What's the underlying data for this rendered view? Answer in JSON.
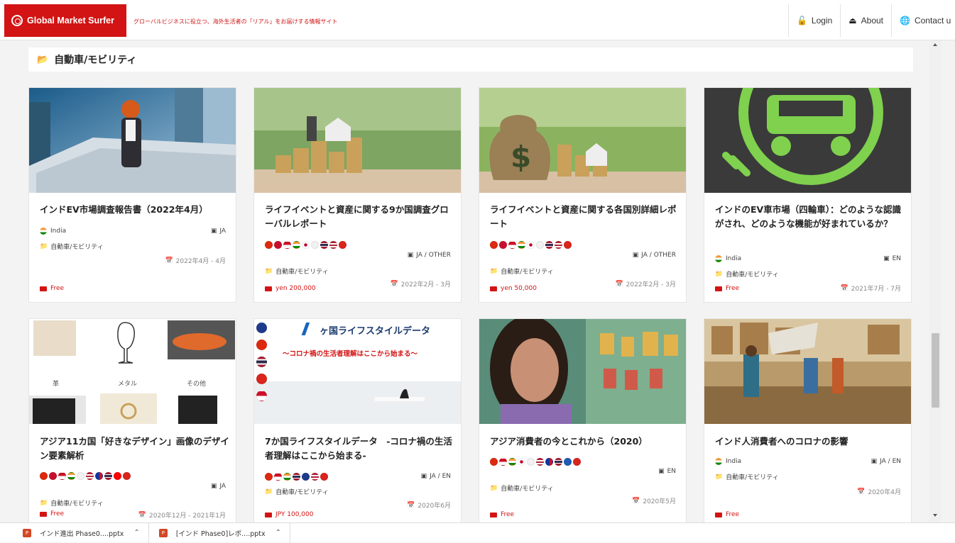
{
  "header": {
    "logo_text": "Global Market Surfer",
    "tagline": "グローバルビジネスに役立つ、海外生活者の「リアル」をお届けする情報サイト",
    "nav": [
      {
        "label": "Login",
        "icon": "lock-icon"
      },
      {
        "label": "About",
        "icon": "eject-icon"
      },
      {
        "label": "Contact u",
        "icon": "globe-icon"
      }
    ]
  },
  "section": {
    "title": "自動車/モビリティ",
    "icon": "folder-icon"
  },
  "cards": [
    {
      "title": "インドEV市場調査報告書（2022年4月）",
      "country": "India",
      "lang": "JA",
      "category": "自動車/モビリティ",
      "date": "2022年4月 - 4月",
      "price": "Free"
    },
    {
      "title": "ライフイベントと資産に関する9か国調査グローバルレポート",
      "lang": "JA / OTHER",
      "category": "自動車/モビリティ",
      "date": "2022年2月 - 3月",
      "price": "yen 200,000"
    },
    {
      "title": "ライフイベントと資産に関する各国別詳細レポート",
      "lang": "JA / OTHER",
      "category": "自動車/モビリティ",
      "date": "2022年2月 - 3月",
      "price": "yen 50,000"
    },
    {
      "title": "インドのEV車市場（四輪車）：どのような認識がされ、どのような機能が好まれているか？",
      "country": "India",
      "lang": "EN",
      "category": "自動車/モビリティ",
      "date": "2021年7月 - 7月",
      "price": "Free"
    },
    {
      "title": "アジア11カ国「好きなデザイン」画像のデザイン要素解析",
      "lang": "JA",
      "category": "自動車/モビリティ",
      "date": "2020年12月 - 2021年1月",
      "price": "Free",
      "image_labels": [
        "革",
        "メタル",
        "その他"
      ]
    },
    {
      "title": "7か国ライフスタイルデータ　-コロナ禍の生活者理解はここから始まる-",
      "lang": "JA / EN",
      "category": "自動車/モビリティ",
      "date": "2020年6月",
      "price": "JPY 100,000",
      "image_heading": "ヶ国ライフスタイルデータ",
      "image_sub": "～コロナ禍の生活者理解はここから始まる～"
    },
    {
      "title": "アジア消費者の今とこれから（2020）",
      "lang": "EN",
      "category": "自動車/モビリティ",
      "date": "2020年5月",
      "price": "Free"
    },
    {
      "title": "インド人消費者へのコロナの影響",
      "country": "India",
      "lang": "JA / EN",
      "category": "自動車/モビリティ",
      "date": "2020年4月",
      "price": "Free"
    }
  ],
  "downloads": [
    {
      "name": "インド進出 Phase0....pptx"
    },
    {
      "name": "[インド Phase0]レポ....pptx"
    }
  ],
  "colors": {
    "brand": "#d21414",
    "ev_green": "#7fd14e"
  }
}
